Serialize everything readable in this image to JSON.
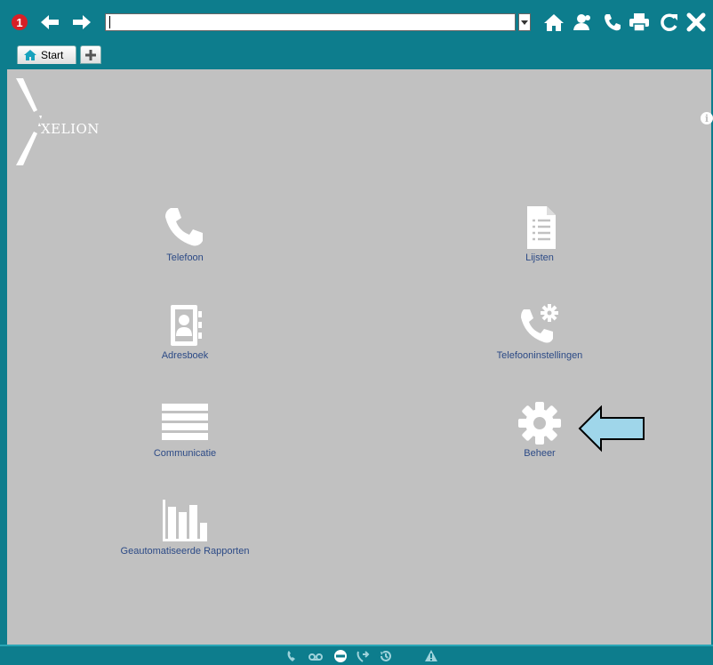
{
  "toolbar": {
    "notification_count": "1",
    "address_value": "",
    "icons": [
      "back-icon",
      "forward-icon",
      "dropdown-icon",
      "home-icon",
      "contacts-icon",
      "phone-icon",
      "print-icon",
      "refresh-icon",
      "close-icon"
    ]
  },
  "tabs": [
    {
      "label": "Start",
      "icon": "home-icon"
    },
    {
      "label": "",
      "icon": "plus-icon"
    }
  ],
  "logo": {
    "text": "XELION"
  },
  "tiles": [
    {
      "label": "Telefoon",
      "icon": "phone-icon"
    },
    {
      "label": "Lijsten",
      "icon": "list-document-icon"
    },
    {
      "label": "Adresboek",
      "icon": "addressbook-icon"
    },
    {
      "label": "Telefooninstellingen",
      "icon": "phone-settings-icon"
    },
    {
      "label": "Communicatie",
      "icon": "communication-bars-icon"
    },
    {
      "label": "Beheer",
      "icon": "gear-icon"
    },
    {
      "label": "Geautomatiseerde Rapporten",
      "icon": "bar-chart-icon"
    }
  ],
  "statusbar": {
    "icons": [
      "call-icon",
      "voicemail-icon",
      "do-not-disturb-icon",
      "forward-call-icon",
      "history-icon",
      "warning-icon"
    ]
  },
  "colors": {
    "chrome": "#0d7d8d",
    "content_bg": "#c1c1c1",
    "tile_label": "#2c4a86",
    "badge": "#d81f26",
    "arrow_fill": "#9fd6ea"
  }
}
